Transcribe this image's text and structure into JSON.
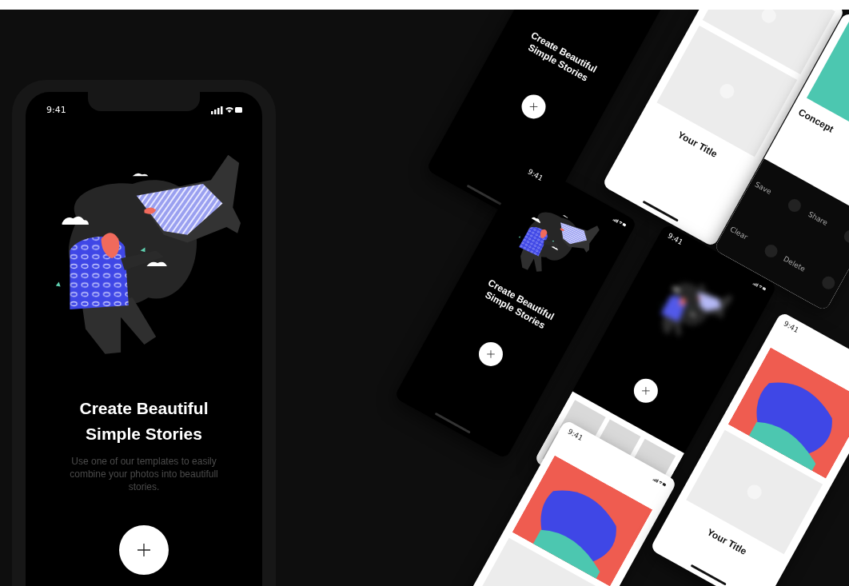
{
  "phone": {
    "status_time": "9:41",
    "title_lines": [
      "Create Beautiful",
      "Simple Stories"
    ],
    "subtitle": "Use one of our templates to easily combine your photos into beautifull stories."
  },
  "showcase": [
    {
      "kind": "intro",
      "title_lines": [
        "Create Beautiful",
        "Simple Stories"
      ]
    },
    {
      "kind": "template",
      "title": "Your Title"
    },
    {
      "kind": "concept",
      "title": "Concept",
      "actions": [
        "Save",
        "Share",
        "Clear",
        "Delete"
      ]
    },
    {
      "kind": "intro",
      "status_time": "9:41",
      "title_lines": [
        "Create Beautiful",
        "Simple Stories"
      ]
    },
    {
      "kind": "picker",
      "status_time": "9:41"
    },
    {
      "kind": "story",
      "status_time": "9:41",
      "title": "Your Title"
    },
    {
      "kind": "story",
      "status_time": "9:41"
    }
  ]
}
